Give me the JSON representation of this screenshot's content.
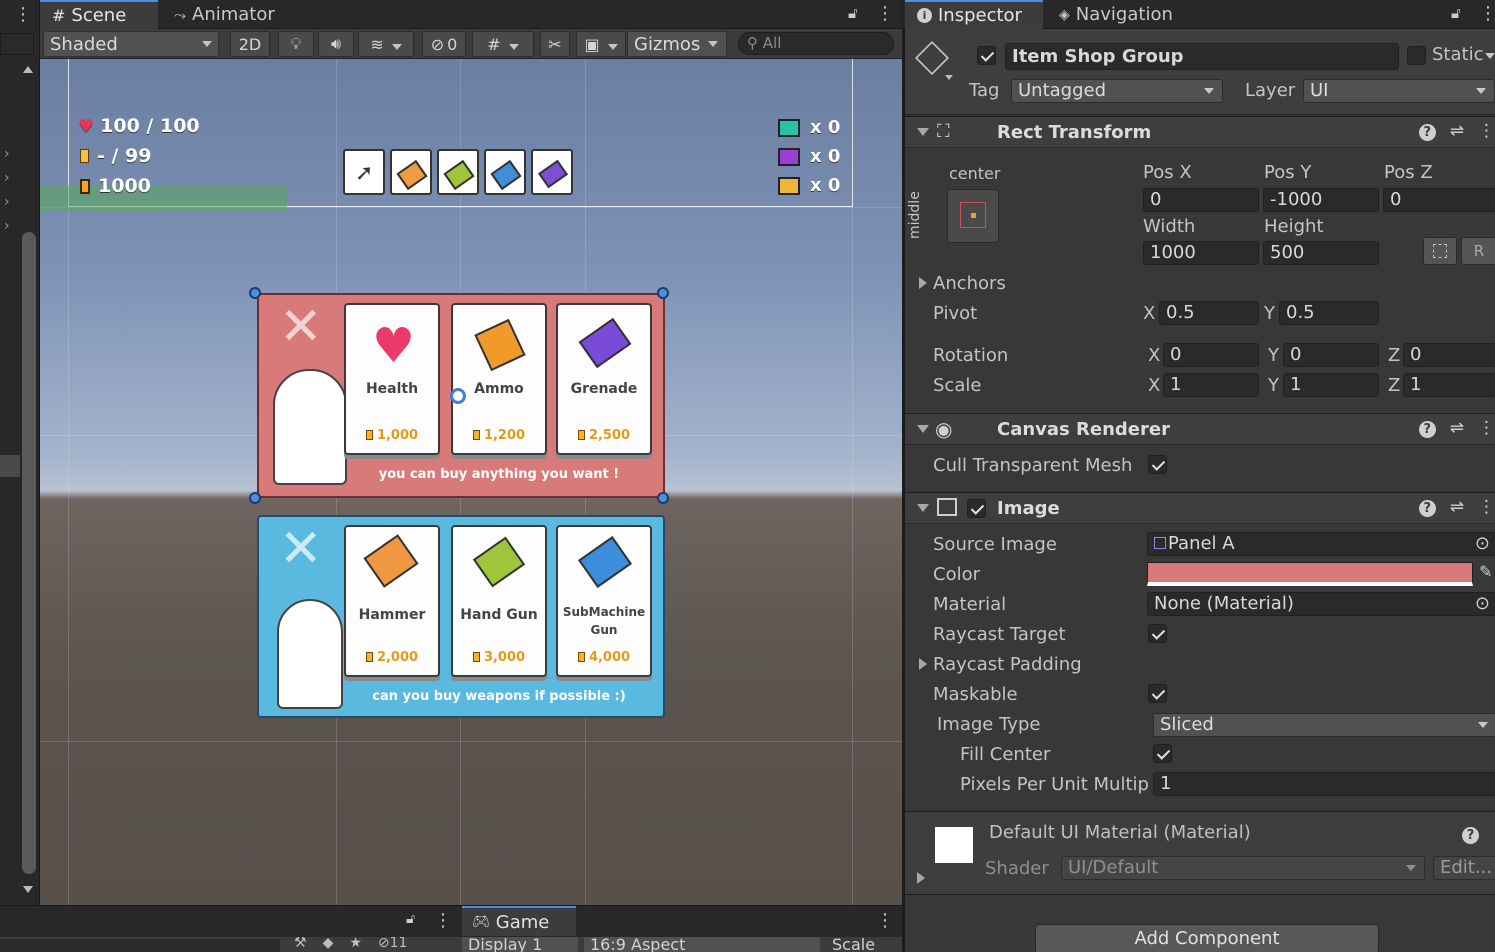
{
  "scene_tabs": {
    "scene": "Scene",
    "animator": "Animator"
  },
  "scene_toolbar": {
    "shading": "Shaded",
    "mode_2d": "2D",
    "hidden_count": "0",
    "gizmos": "Gizmos",
    "search_placeholder": "All"
  },
  "hud": {
    "health": "100 / 100",
    "ammo": "- / 99",
    "gold": "1000",
    "counters": [
      "x 0",
      "x 0",
      "x 0"
    ]
  },
  "shop": {
    "red_panel": {
      "items": [
        {
          "name": "Health",
          "price": "1,000"
        },
        {
          "name": "Ammo",
          "price": "1,200"
        },
        {
          "name": "Grenade",
          "price": "2,500"
        }
      ],
      "caption": "you can buy anything you want !"
    },
    "blue_panel": {
      "items": [
        {
          "name": "Hammer",
          "price": "2,000"
        },
        {
          "name": "Hand Gun",
          "price": "3,000"
        },
        {
          "name": "SubMachine Gun",
          "price": "4,000"
        }
      ],
      "caption": "can you buy weapons if possible :)"
    }
  },
  "inspector_tabs": {
    "inspector": "Inspector",
    "navigation": "Navigation"
  },
  "gameobject": {
    "name": "Item Shop Group",
    "static_label": "Static",
    "tag_label": "Tag",
    "tag": "Untagged",
    "layer_label": "Layer",
    "layer": "UI"
  },
  "rect_transform": {
    "title": "Rect Transform",
    "anchor_h": "center",
    "anchor_v": "middle",
    "pos_x_label": "Pos X",
    "pos_y_label": "Pos Y",
    "pos_z_label": "Pos Z",
    "pos_x": "0",
    "pos_y": "-1000",
    "pos_z": "0",
    "width_label": "Width",
    "height_label": "Height",
    "width": "1000",
    "height": "500",
    "anchors_label": "Anchors",
    "pivot_label": "Pivot",
    "pivot_x": "0.5",
    "pivot_y": "0.5",
    "rotation_label": "Rotation",
    "rot_x": "0",
    "rot_y": "0",
    "rot_z": "0",
    "scale_label": "Scale",
    "scale_x": "1",
    "scale_y": "1",
    "scale_z": "1",
    "x": "X",
    "y": "Y",
    "z": "Z",
    "r": "R"
  },
  "canvas_renderer": {
    "title": "Canvas Renderer",
    "cull_label": "Cull Transparent Mesh"
  },
  "image": {
    "title": "Image",
    "source_label": "Source Image",
    "source": "Panel A",
    "color_label": "Color",
    "color": "#d97a7a",
    "material_label": "Material",
    "material": "None (Material)",
    "raycast_target_label": "Raycast Target",
    "raycast_padding_label": "Raycast Padding",
    "maskable_label": "Maskable",
    "image_type_label": "Image Type",
    "image_type": "Sliced",
    "fill_center_label": "Fill Center",
    "ppu_label": "Pixels Per Unit Multip",
    "ppu": "1"
  },
  "material_block": {
    "title": "Default UI Material (Material)",
    "shader_label": "Shader",
    "shader": "UI/Default",
    "edit": "Edit..."
  },
  "add_component": "Add Component",
  "game_bar": {
    "game_tab": "Game",
    "layers_count": "11",
    "display": "Display 1",
    "aspect": "16:9 Aspect",
    "scale": "Scale"
  }
}
